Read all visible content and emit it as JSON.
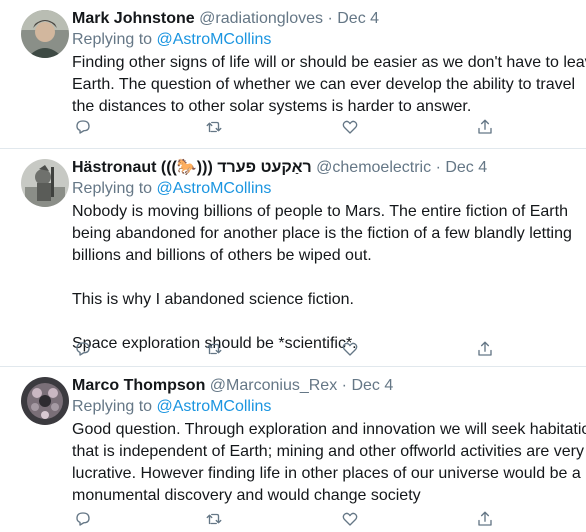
{
  "tweets": [
    {
      "name": "Mark Johnstone",
      "handle": "@radiationgloves",
      "separator": "·",
      "date": "Dec 4",
      "replying_prefix": "Replying to ",
      "replying_to": "@AstroMCollins",
      "lines": [
        "Finding other signs of life will or should be easier as we don't have to leave",
        "Earth. The question of whether we can ever develop the ability to travel",
        "the distances to other solar systems is harder to answer."
      ]
    },
    {
      "name": "Hästronaut (((🐎))) ראַקעט פערד",
      "handle": "@chemoelectric",
      "separator": "·",
      "date": "Dec 4",
      "replying_prefix": "Replying to ",
      "replying_to": "@AstroMCollins",
      "lines": [
        "Nobody is moving billions of people to Mars. The entire fiction of Earth",
        "being abandoned for another place is the fiction of a few blandly letting",
        "billions and billions of others be wiped out.",
        "",
        "This is why I abandoned science fiction.",
        "",
        "Space exploration should be *scientific*."
      ]
    },
    {
      "name": "Marco Thompson",
      "handle": "@Marconius_Rex",
      "separator": "·",
      "date": "Dec 4",
      "replying_prefix": "Replying to ",
      "replying_to": "@AstroMCollins",
      "lines": [
        "Good question. Through exploration and innovation we will seek habitation",
        "that is independent of Earth; mining and other offworld activities are very",
        "lucrative. However finding life in other places of our universe would be a",
        "monumental discovery and would change society"
      ]
    }
  ],
  "icons": {
    "reply": "reply-icon",
    "retweet": "retweet-icon",
    "like": "like-icon",
    "share": "share-icon"
  },
  "colors": {
    "text": "#14171a",
    "muted": "#657786",
    "link": "#1b95e0",
    "divider": "#e1e8ed"
  }
}
